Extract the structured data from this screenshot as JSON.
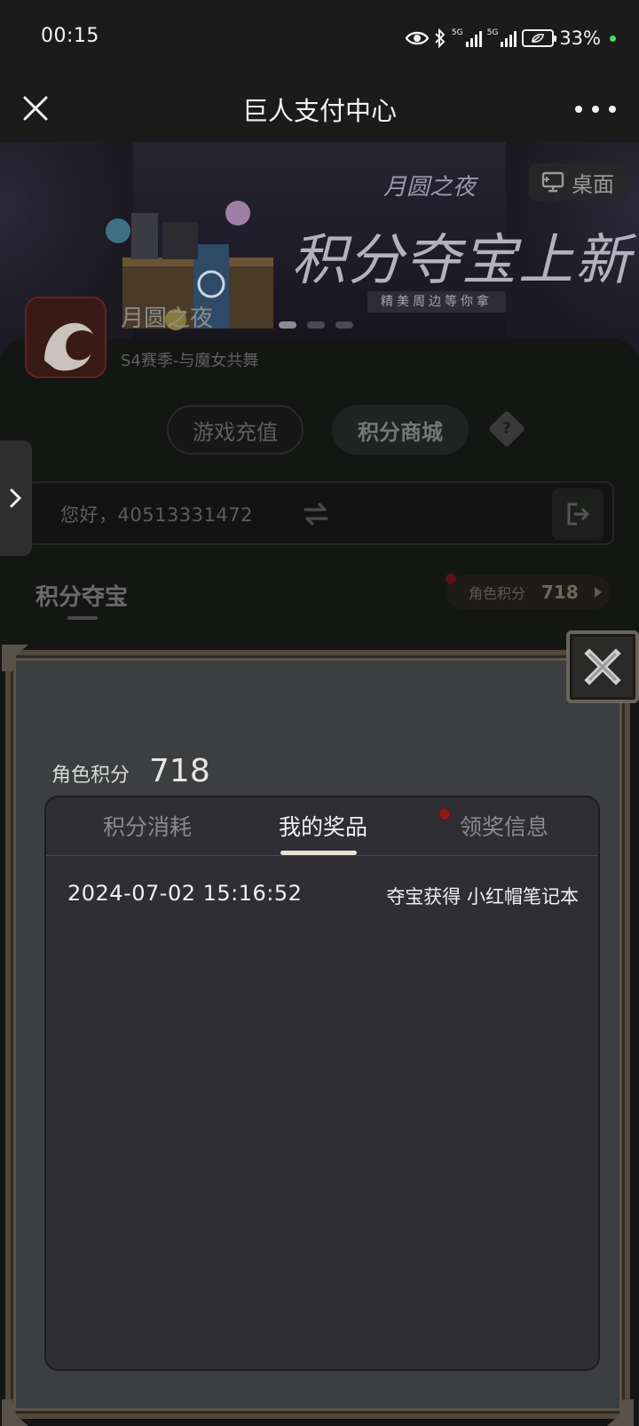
{
  "status_bar": {
    "time": "00:15",
    "battery": "33%",
    "network": [
      "5G",
      "5G"
    ],
    "icons": [
      "eye-icon",
      "bluetooth-icon",
      "signal-icon",
      "battery-icon"
    ]
  },
  "title_bar": {
    "title": "巨人支付中心",
    "close_icon": "close-icon",
    "more_icon": "more-icon"
  },
  "banner": {
    "logo": "月圆之夜",
    "headline": "积分夺宝上新",
    "subline": "精美周边等你拿",
    "desktop_label": "桌面",
    "slides": 3,
    "active_slide": 1
  },
  "game": {
    "name": "月圆之夜",
    "season": "S4赛季-与魔女共舞"
  },
  "mode_tabs": {
    "recharge": "游戏充值",
    "shop": "积分商城",
    "help": "?"
  },
  "greeting": {
    "text": "您好，40513331472"
  },
  "section": {
    "title": "积分夺宝",
    "points_label": "角色积分",
    "points_value": "718"
  },
  "modal": {
    "points_label": "角色积分",
    "points_value": "718",
    "tabs": [
      "积分消耗",
      "我的奖品",
      "领奖信息"
    ],
    "active_tab": 1,
    "records": [
      {
        "time": "2024-07-02 15:16:52",
        "description": "夺宝获得 小红帽笔记本"
      }
    ]
  },
  "colors": {
    "modal_frame": "#51473a",
    "modal_bg": "#3c3e3f",
    "record_bg": "#2f2f33",
    "tab_indicator": "#e8e2d6",
    "notification_dot": "#8a1a1a"
  }
}
